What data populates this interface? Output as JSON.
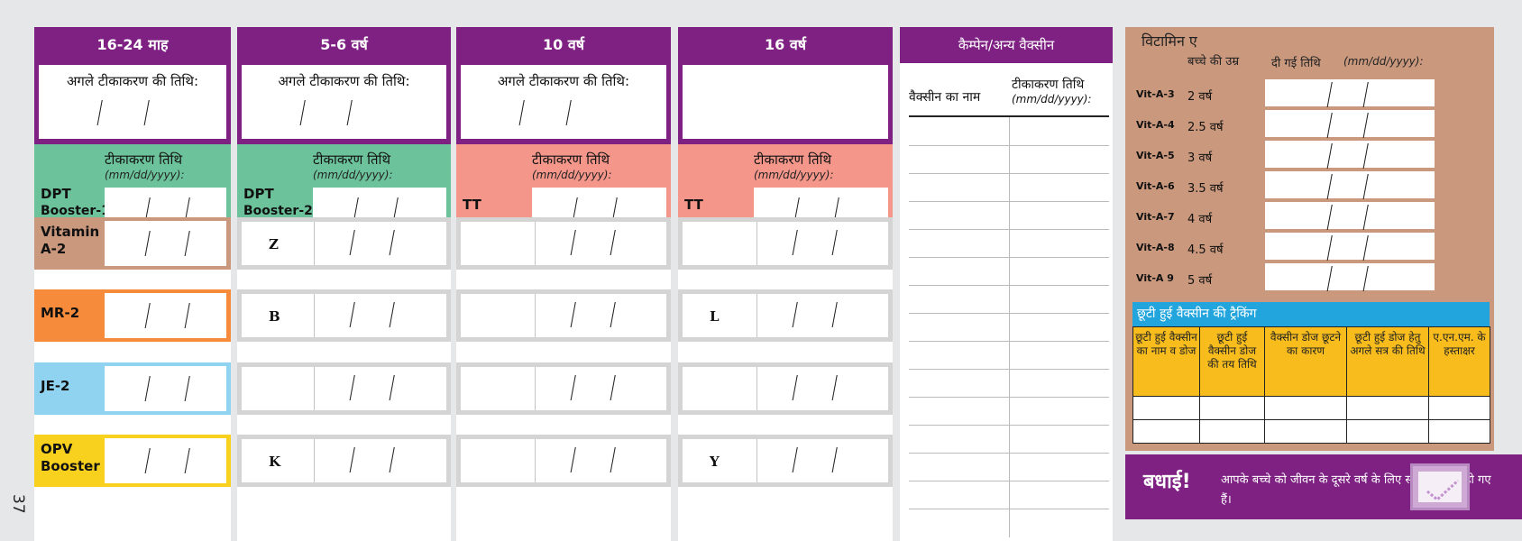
{
  "page_number": "37",
  "next_date_label": "अगले टीकाकरण की तिथि:",
  "date_label": "टीकाकरण तिथि",
  "date_format": "(mm/dd/yyyy):",
  "columns": [
    {
      "header": "16-24 माह",
      "main_dose": [
        "DPT",
        "Booster-1"
      ],
      "rows": [
        "Vitamin A-2",
        "MR-2",
        "JE-2",
        "OPV Booster"
      ]
    },
    {
      "header": "5-6 वर्ष",
      "main_dose": [
        "DPT",
        "Booster-2"
      ],
      "rows": [
        "Z",
        "B",
        "",
        "K"
      ]
    },
    {
      "header": "10 वर्ष",
      "main_dose": [
        "TT"
      ],
      "rows": [
        "",
        "",
        "",
        ""
      ]
    },
    {
      "header": "16 वर्ष",
      "main_dose": [
        "TT"
      ],
      "rows": [
        "",
        "L",
        "",
        "Y"
      ]
    }
  ],
  "campaign": {
    "header": "कैम्पेन/अन्य वैक्सीन",
    "name_label": "वैक्सीन का नाम",
    "date_label": "टीकाकरण तिथि",
    "date_format": "(mm/dd/yyyy):"
  },
  "vitamin": {
    "title": "विटामिन ए",
    "age_label": "बच्चे की उम्र",
    "date_label": "दी गई तिथि",
    "date_format": "(mm/dd/yyyy):",
    "rows": [
      {
        "code": "Vit-A-3",
        "age": "2 वर्ष"
      },
      {
        "code": "Vit-A-4",
        "age": "2.5 वर्ष"
      },
      {
        "code": "Vit-A-5",
        "age": "3 वर्ष"
      },
      {
        "code": "Vit-A-6",
        "age": "3.5 वर्ष"
      },
      {
        "code": "Vit-A-7",
        "age": "4 वर्ष"
      },
      {
        "code": "Vit-A-8",
        "age": "4.5 वर्ष"
      },
      {
        "code": "Vit-A 9",
        "age": "5 वर्ष"
      }
    ]
  },
  "tracking": {
    "title": "छूटी हुई वैक्सीन की ट्रैकिंग",
    "headers": [
      "छूटी हुई वैक्सीन का नाम व डोज",
      "छूटी हुई वैक्सीन डोज की तय तिथि",
      "वैक्सीन डोज छूटने का कारण",
      "छूटी हुई डोज हेतु अगले सत्र की तिथि",
      "ए.एन.एम. के हस्ताक्षर"
    ]
  },
  "badhai": {
    "word": "बधाई!",
    "text": "आपके बच्चे को जीवन के दूसरे वर्ष के लिए सभी टीके पूरे हो गए हैं।"
  },
  "colors": {
    "purple": "#7e2183",
    "green": "#6cc39b",
    "salmon": "#f4968a",
    "tan": "#c9987d",
    "orange": "#f68b3c",
    "lightblue": "#8fd3f1",
    "yellow": "#f8d01e",
    "cyan": "#22a5dc",
    "tracking_yellow": "#f8bd1d"
  }
}
